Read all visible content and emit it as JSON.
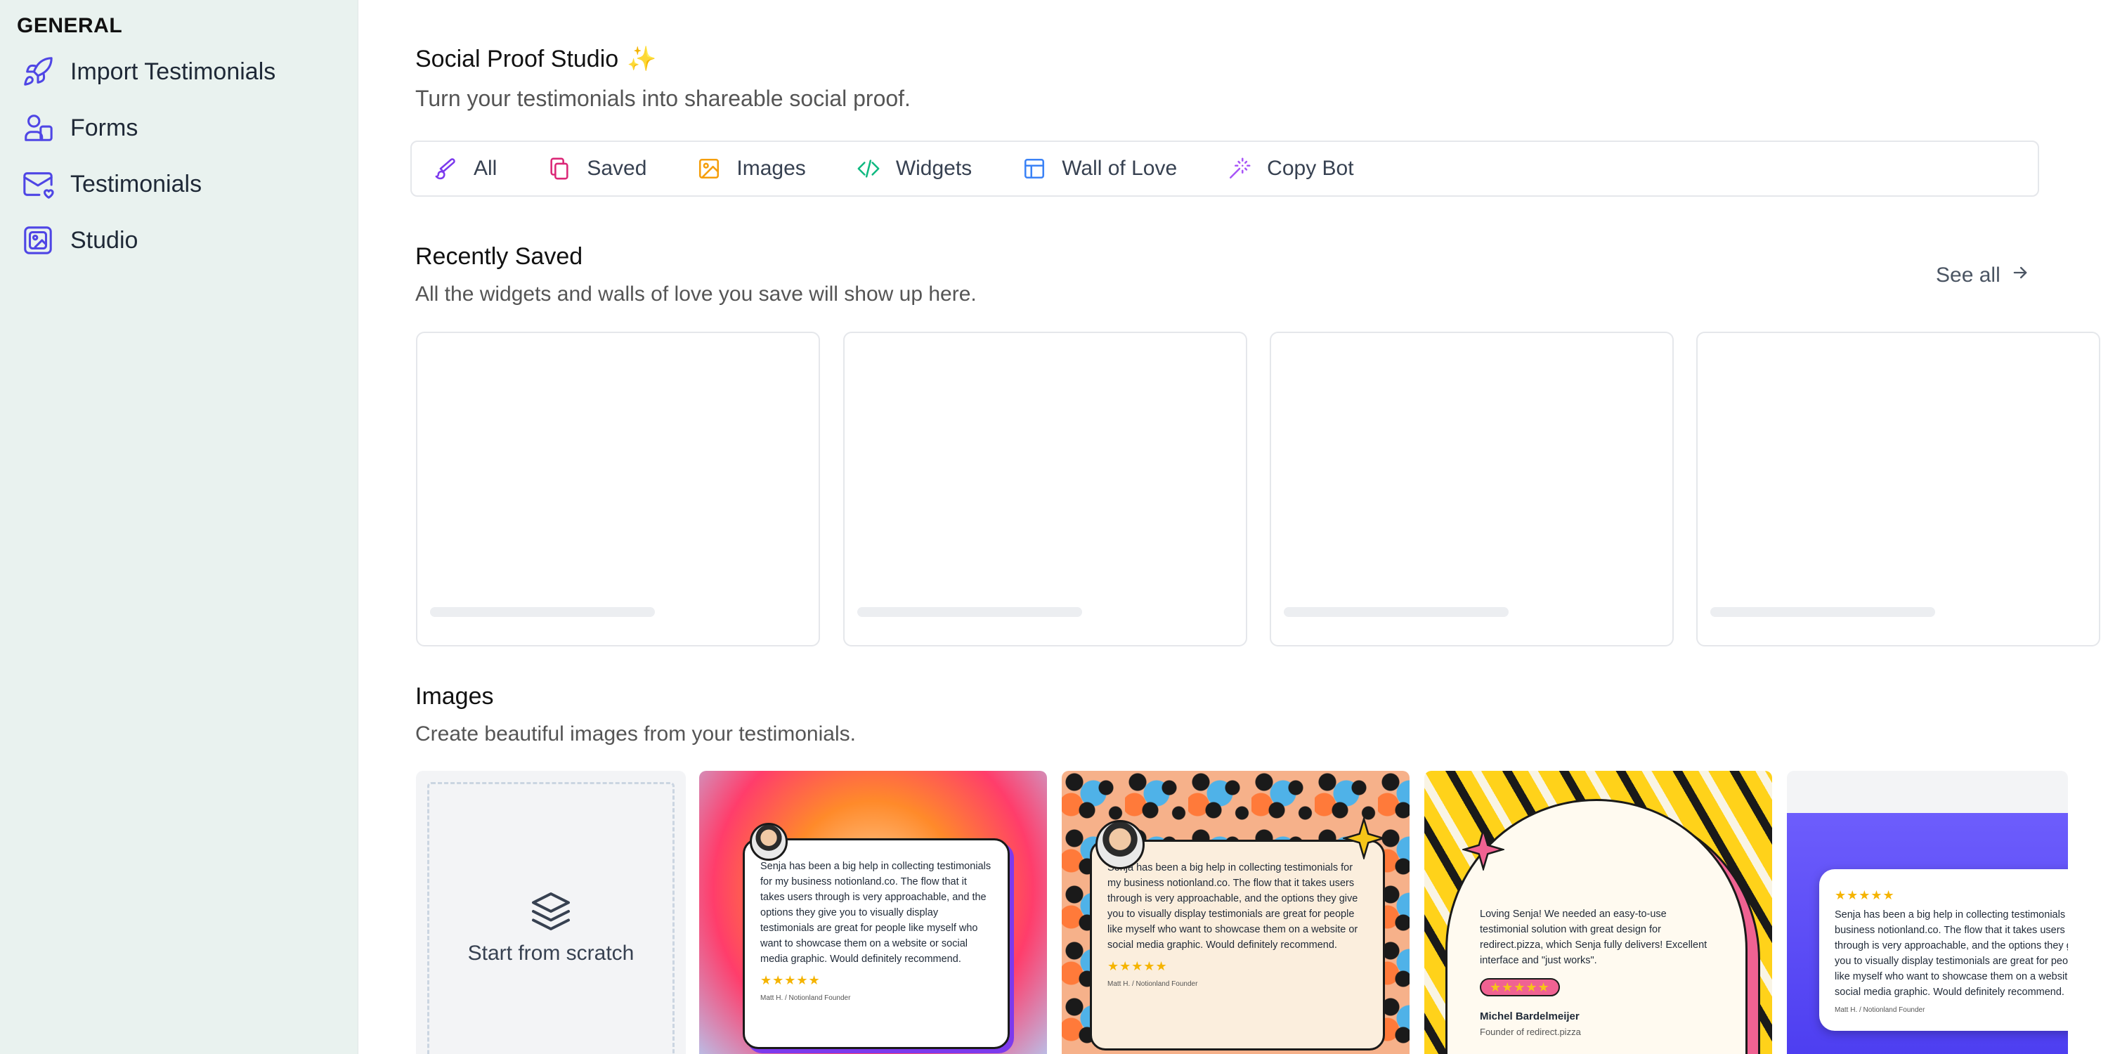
{
  "sidebar": {
    "section_title": "GENERAL",
    "items": [
      {
        "label": "Import Testimonials",
        "icon": "rocket-icon"
      },
      {
        "label": "Forms",
        "icon": "users-icon"
      },
      {
        "label": "Testimonials",
        "icon": "mail-heart-icon"
      },
      {
        "label": "Studio",
        "icon": "image-frame-icon"
      }
    ]
  },
  "header": {
    "title": "Social Proof Studio",
    "title_emoji": "✨",
    "subtitle": "Turn your testimonials into shareable social proof."
  },
  "tabs": [
    {
      "label": "All",
      "icon": "brush-icon",
      "color": "#7c3aed"
    },
    {
      "label": "Saved",
      "icon": "copy-icon",
      "color": "#db2777"
    },
    {
      "label": "Images",
      "icon": "image-icon",
      "color": "#f59e0b"
    },
    {
      "label": "Widgets",
      "icon": "code-icon",
      "color": "#10b981"
    },
    {
      "label": "Wall of Love",
      "icon": "layout-icon",
      "color": "#3b82f6"
    },
    {
      "label": "Copy Bot",
      "icon": "magic-wand-icon",
      "color": "#a855f7"
    }
  ],
  "recently_saved": {
    "title": "Recently Saved",
    "subtitle": "All the widgets and walls of love you save will show up here.",
    "see_all": "See all"
  },
  "images_section": {
    "title": "Images",
    "subtitle": "Create beautiful images from your testimonials.",
    "scratch_label": "Start from scratch",
    "templates": [
      {
        "text": "Senja has been a big help in collecting testimonials for my business notionland.co. The flow that it takes users through is very approachable, and the options they give you to visually display testimonials are great for people like myself who want to showcase them on a website or social media graphic. Would definitely recommend.",
        "stars": "★★★★★",
        "author": "Matt H. / Notionland Founder"
      },
      {
        "text": "Senja has been a big help in collecting testimonials for my business notionland.co. The flow that it takes users through is very approachable, and the options they give you to visually display testimonials are great for people like myself who want to showcase them on a website or social media graphic. Would definitely recommend.",
        "stars": "★★★★★",
        "author": "Matt H. / Notionland Founder"
      },
      {
        "text": "Loving Senja! We needed an easy-to-use testimonial solution with great design for redirect.pizza, which Senja fully delivers! Excellent interface and \"just works\".",
        "stars": "★★★★★",
        "author": "Michel Bardelmeijer",
        "author_role": "Founder of redirect.pizza"
      },
      {
        "text": "Senja has been a big help in collecting testimonials for my business notionland.co. The flow that it takes users through is very approachable, and the options they give you to visually display testimonials are great for people like myself who want to showcase them on a website or social media graphic. Would definitely recommend.",
        "stars": "★★★★★",
        "author": "Matt H. / Notionland Founder"
      }
    ]
  }
}
